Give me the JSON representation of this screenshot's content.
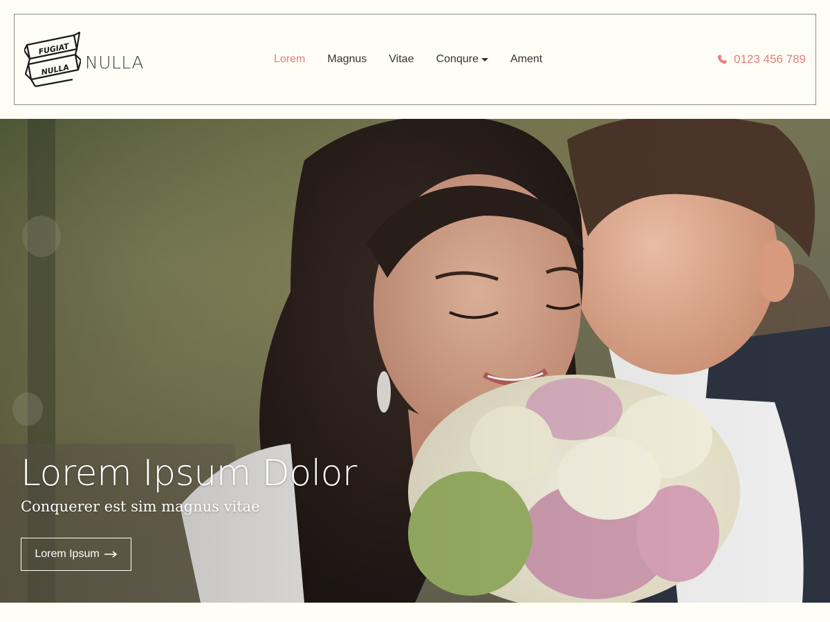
{
  "header": {
    "logo": {
      "banner_text_top": "FUGIAT",
      "banner_text_bottom": "NULLA",
      "icon": "ribbon-logo-icon"
    },
    "brand_name": "NULLA",
    "nav": {
      "items": [
        {
          "label": "Lorem",
          "active": true
        },
        {
          "label": "Magnus",
          "active": false
        },
        {
          "label": "Vitae",
          "active": false
        },
        {
          "label": "Conqure",
          "active": false,
          "dropdown": true
        },
        {
          "label": "Ament",
          "active": false
        }
      ]
    },
    "phone": {
      "icon": "phone-icon",
      "number": "0123 456 789"
    }
  },
  "hero": {
    "title": "Lorem Ipsum Dolor",
    "subtitle": "Conquerer est sim magnus vitae",
    "button_label": "Lorem Ipsum",
    "button_icon": "arrow-right-icon"
  },
  "colors": {
    "accent": "#e67c7c",
    "background": "#fefef6",
    "nav_text": "#333333",
    "border": "#8a8a8a"
  }
}
